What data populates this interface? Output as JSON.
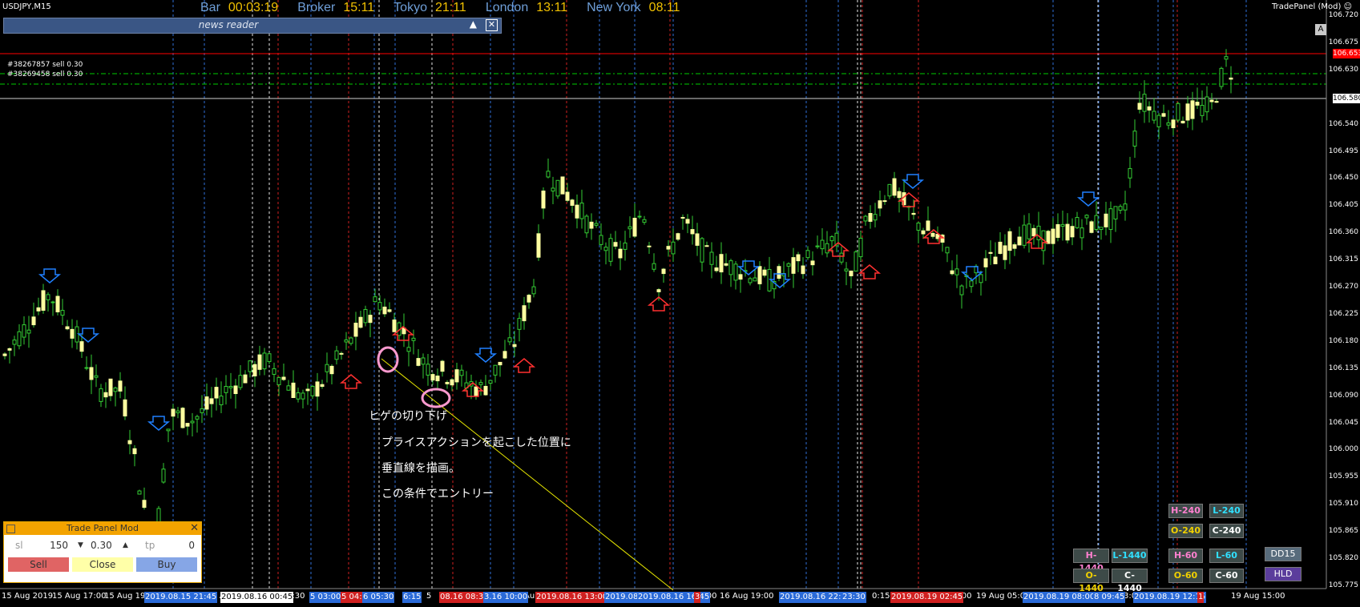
{
  "symbol": "USDJPY,M15",
  "trade_panel_title": "TradePanel (Mod)",
  "clock": {
    "items": [
      {
        "label": "Bar",
        "value": "00:03:19"
      },
      {
        "label": "Broker",
        "value": "15:11"
      },
      {
        "label": "Tokyo",
        "value": "21:11"
      },
      {
        "label": "London",
        "value": "13:11"
      },
      {
        "label": "New York",
        "value": "08:11"
      }
    ]
  },
  "news_reader": {
    "title": "news reader",
    "collapse_icon": "triangle-up-icon",
    "close_icon": "close-icon"
  },
  "orders": [
    "#38267857 sell 0.30",
    "#38269458 sell 0.30"
  ],
  "annotation": {
    "line1": "ヒゲの切り下げ",
    "line2": "プライスアクションを起こした位置に",
    "line3": "垂直線を描画。",
    "line4": "この条件でエントリー"
  },
  "price_axis": {
    "labels": [
      "106.720",
      "106.675",
      "106.630",
      "106.540",
      "106.495",
      "106.450",
      "106.405",
      "106.360",
      "106.315",
      "106.270",
      "106.225",
      "106.180",
      "106.135",
      "106.090",
      "106.045",
      "106.000",
      "105.955",
      "105.910",
      "105.865",
      "105.820",
      "105.775"
    ],
    "current_price": "106.653",
    "line_price": "106.580",
    "button_a": "A"
  },
  "time_axis": {
    "labels": [
      "15 Aug 2019",
      "15 Aug 17:00",
      "15 Aug 19:0",
      "15 A",
      "1:30",
      "7:00",
      "16 Aug 19:00",
      "0:15",
      "3:00",
      "19 Aug 05:00",
      "3:00",
      "19 Aug 15:00",
      "Au",
      "5"
    ],
    "boxes_blue": [
      "2019.08.15 21:45",
      "5 03:00",
      "6 05:30",
      "6:15",
      "3.16 10:00",
      "2019.08.16 14:15",
      "2019.08.16 16:45",
      "2019.08.16 22:30",
      "23:30",
      "2019.08.19 08:00",
      "8 09:45",
      "2019.08.19 12:15"
    ],
    "boxes_red": [
      "5 04:30",
      "08.16 08:30",
      "2019.08.16 13:00",
      "3",
      "2019.08.19 02:45",
      "1"
    ],
    "boxes_white": [
      "2019.08.16 00:45"
    ]
  },
  "trade_panel": {
    "title": "Trade Panel Mod",
    "sl_label": "sl",
    "sl_value": "150",
    "lot_value": "0.30",
    "tp_label": "tp",
    "tp_value": "0",
    "sell": "Sell",
    "close": "Close",
    "buy": "Buy"
  },
  "hl_buttons": {
    "h240": "H-240",
    "l240": "L-240",
    "o240": "O-240",
    "c240": "C-240",
    "h1440": "H-1440",
    "l1440": "L-1440",
    "o1440": "O-1440",
    "c1440": "C-1440",
    "h60": "H-60",
    "l60": "L-60",
    "o60": "O-60",
    "c60": "C-60",
    "dd15": "DD15",
    "hld": "HLD"
  },
  "colors": {
    "bull": "#ffffa0",
    "bear": "#33cc33",
    "up_arrow": "#ff3030",
    "down_arrow": "#2080ff",
    "red_line": "#ff0000",
    "green_dash": "#00cc00"
  }
}
